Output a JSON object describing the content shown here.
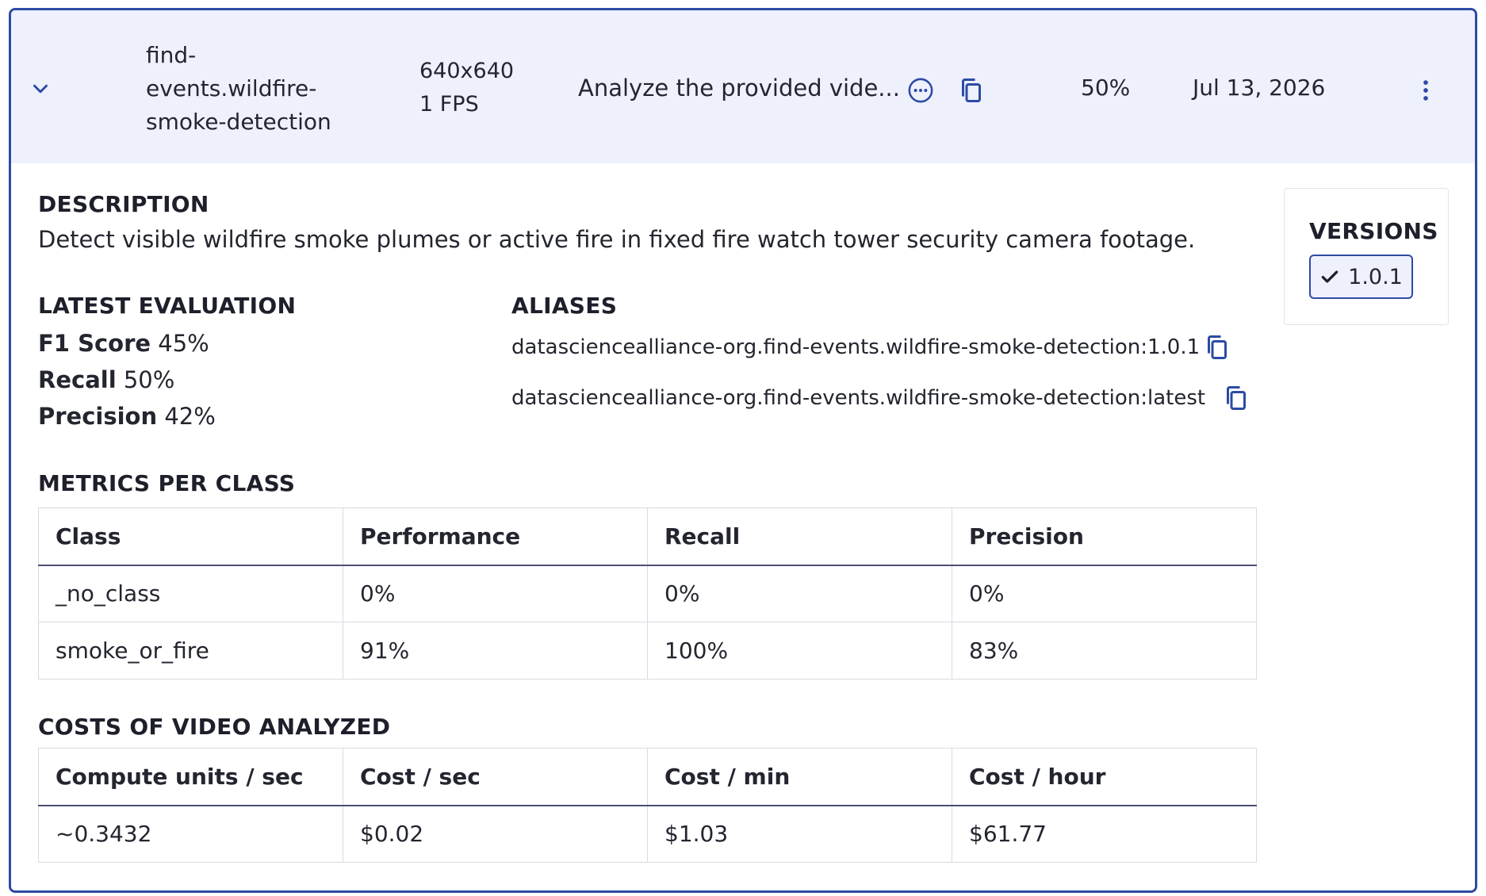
{
  "header": {
    "model_name": "find-events.wildfire-smoke-detection",
    "model_name_lines": [
      "find-",
      "events.wildfire-",
      "smoke-detection"
    ],
    "resolution": "640x640",
    "fps": "1 FPS",
    "prompt_preview": "Analyze the provided vide...",
    "score": "50%",
    "date": "Jul 13, 2026"
  },
  "description": {
    "title": "DESCRIPTION",
    "text": "Detect visible wildfire smoke plumes or active fire in fixed fire watch tower security camera footage."
  },
  "latest_evaluation": {
    "title": "LATEST EVALUATION",
    "metrics": [
      {
        "label": "F1 Score",
        "value": "45%"
      },
      {
        "label": "Recall",
        "value": "50%"
      },
      {
        "label": "Precision",
        "value": "42%"
      }
    ]
  },
  "aliases": {
    "title": "ALIASES",
    "items": [
      "datasciencealliance-org.find-events.wildfire-smoke-detection:1.0.1",
      "datasciencealliance-org.find-events.wildfire-smoke-detection:latest"
    ]
  },
  "versions": {
    "title": "VERSIONS",
    "selected": "1.0.1"
  },
  "metrics_per_class": {
    "title": "METRICS PER CLASS",
    "columns": [
      "Class",
      "Performance",
      "Recall",
      "Precision"
    ],
    "rows": [
      [
        "_no_class",
        "0%",
        "0%",
        "0%"
      ],
      [
        "smoke_or_fire",
        "91%",
        "100%",
        "83%"
      ]
    ]
  },
  "costs": {
    "title": "COSTS OF VIDEO ANALYZED",
    "columns": [
      "Compute units / sec",
      "Cost / sec",
      "Cost / min",
      "Cost / hour"
    ],
    "rows": [
      [
        "~0.3432",
        "$0.02",
        "$1.03",
        "$61.77"
      ]
    ]
  },
  "icons": {
    "expand": "chevron-down-icon",
    "prompt_more": "ellipsis-circle-icon",
    "copy": "copy-icon",
    "menu": "kebab-menu-icon",
    "version_check": "check-icon"
  },
  "colors": {
    "accent": "#2d4ba4",
    "header_bg": "#eef0fc",
    "text": "#23252f"
  }
}
